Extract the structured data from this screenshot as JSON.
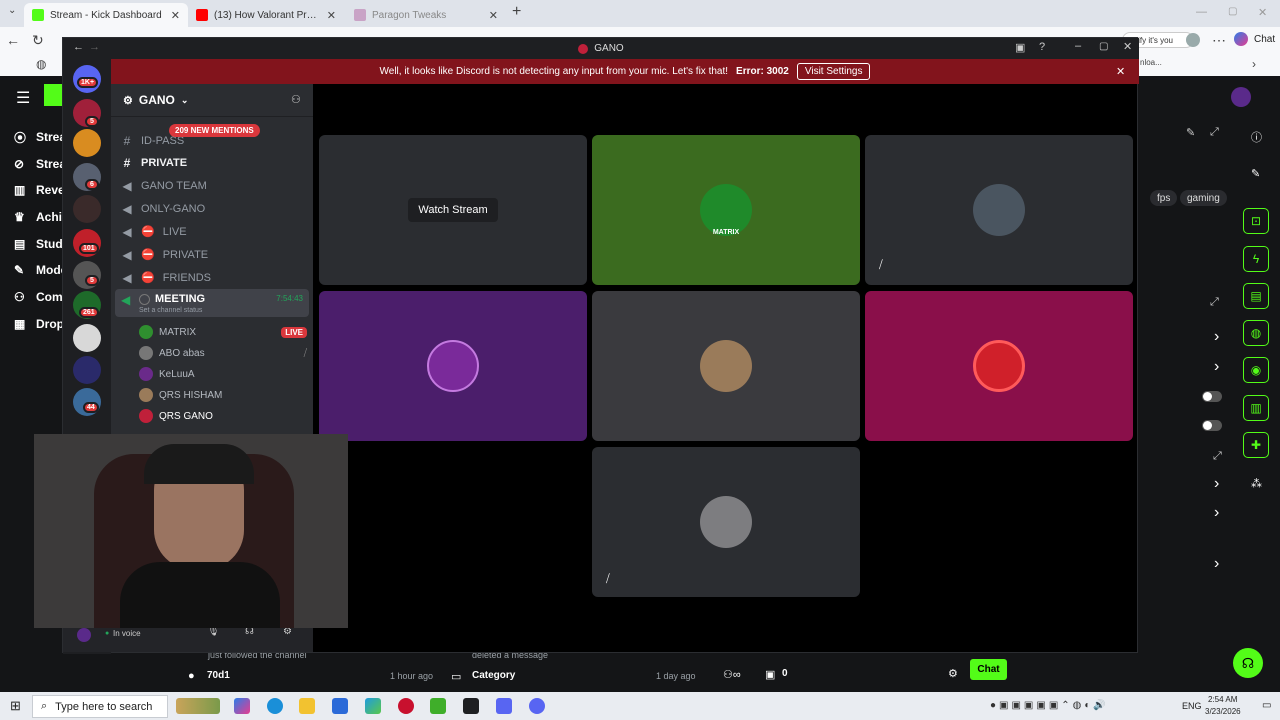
{
  "browser": {
    "tabs": [
      {
        "title": "Stream - Kick Dashboard",
        "color": "#53fc18"
      },
      {
        "title": "(13) How Valorant Pros Optimize W",
        "color": "#ff0000"
      },
      {
        "title": "Paragon Tweaks",
        "color": "#c9a3c6"
      }
    ],
    "close_glyph": "✕",
    "new_tab_glyph": "+",
    "verify_text": "erify it's you",
    "chat_label": "Chat",
    "downloads_text": "nloa..."
  },
  "kick": {
    "nav": [
      {
        "label": "Strea",
        "icon": "radio-icon"
      },
      {
        "label": "Strea",
        "icon": "link-icon"
      },
      {
        "label": "Reve",
        "icon": "chart-icon"
      },
      {
        "label": "Achi",
        "icon": "trophy-icon"
      },
      {
        "label": "Stud",
        "icon": "studio-icon"
      },
      {
        "label": "Mode",
        "icon": "wrench-icon"
      },
      {
        "label": "Com",
        "icon": "community-icon"
      },
      {
        "label": "Drop",
        "icon": "drop-icon"
      }
    ],
    "tags": [
      "fps",
      "gaming"
    ],
    "bottom": {
      "followed_text": "just followed the channel",
      "deleted_text": "deleted a message",
      "user": "70d1",
      "user_time": "1 hour ago",
      "category": "Category",
      "category_time": "1 day ago",
      "count": "0",
      "chat_button": "Chat"
    }
  },
  "discord": {
    "window_title": "GANO",
    "banner_text": "Well, it looks like Discord is not detecting any input from your mic. Let's fix that!",
    "banner_error": "Error: 3002",
    "banner_button": "Visit Settings",
    "server_badges": [
      "1K+",
      "5",
      "6",
      "101",
      "5",
      "261",
      "44"
    ],
    "guild_name": "GANO",
    "mentions": "209 NEW MENTIONS",
    "channels": [
      {
        "name": "ID-PASS",
        "type": "text",
        "bold": false
      },
      {
        "name": "PRIVATE",
        "type": "text",
        "bold": true
      },
      {
        "name": "GANO TEAM",
        "type": "voice",
        "bold": false
      },
      {
        "name": "ONLY-GANO",
        "type": "voice",
        "bold": false
      },
      {
        "name": "LIVE",
        "type": "voice",
        "bold": false
      },
      {
        "name": "PRIVATE",
        "type": "voice",
        "bold": false
      },
      {
        "name": "FRIENDS",
        "type": "voice",
        "bold": false
      }
    ],
    "meeting": {
      "name": "MEETING",
      "timer": "7:54:43",
      "status": "Set a channel status"
    },
    "voice_users": [
      {
        "name": "MATRIX",
        "live": true,
        "color": "#2f8f2f"
      },
      {
        "name": "ABO abas",
        "live": false,
        "color": "#777"
      },
      {
        "name": "KeLuuA",
        "live": false,
        "color": "#6a2a8a"
      },
      {
        "name": "QRS HISHAM",
        "live": false,
        "color": "#9a7b5a"
      },
      {
        "name": "QRS GANO",
        "live": false,
        "color": "#c0203a"
      }
    ],
    "live_label": "LIVE",
    "in_voice": "In voice",
    "watch_stream": "Watch Stream",
    "tiles": [
      {
        "bg": "#2b2d31",
        "avatar": null,
        "label": "Watch Stream"
      },
      {
        "bg": "#3b6b1f",
        "avatar": "#1f8a2a",
        "label": "MATRIX"
      },
      {
        "bg": "#2b2d31",
        "avatar": "#4a5560"
      },
      {
        "bg": "#4b1e6b",
        "avatar": "#7a2a9a"
      },
      {
        "bg": "#3a3a3e",
        "avatar": "#9a7b5a"
      },
      {
        "bg": "#8a0f4a",
        "avatar": "#d0202a"
      },
      {
        "bg": "#2b2d31",
        "avatar": "#7d7d80"
      }
    ]
  },
  "taskbar": {
    "search_placeholder": "Type here to search",
    "language": "ENG",
    "time": "2:54 AM",
    "date": "3/23/2026"
  }
}
